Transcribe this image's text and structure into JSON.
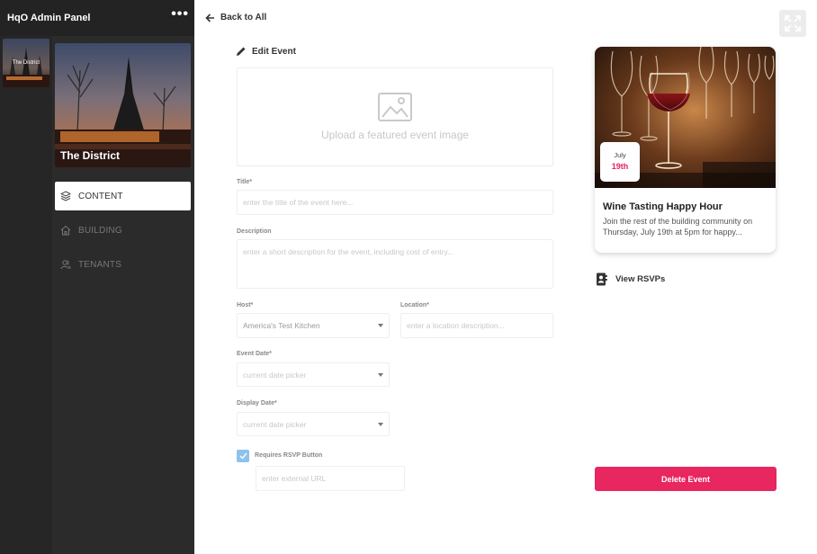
{
  "app": {
    "title": "HqO Admin Panel",
    "menu_icon": "more-dots-icon"
  },
  "sidebar": {
    "property_thumb_small_label": "The District",
    "property_name": "The District",
    "nav": [
      {
        "label": "CONTENT",
        "icon": "layers-icon",
        "active": true
      },
      {
        "label": "BUILDING",
        "icon": "home-icon",
        "active": false
      },
      {
        "label": "TENANTS",
        "icon": "users-icon",
        "active": false
      }
    ]
  },
  "header": {
    "back_label": "Back to All",
    "expand_icon": "expand-icon"
  },
  "form": {
    "section_title": "Edit Event",
    "upload_text": "Upload a featured event image",
    "title": {
      "label": "Title*",
      "placeholder": "enter the title of the event here..."
    },
    "description": {
      "label": "Description",
      "placeholder": "enter a short description for the event, including cost of entry..."
    },
    "host": {
      "label": "Host*",
      "value": "America's Test Kitchen"
    },
    "location": {
      "label": "Location*",
      "placeholder": "enter a location description..."
    },
    "event_date": {
      "label": "Event Date*",
      "placeholder": "current date picker"
    },
    "display_date": {
      "label": "Display Date*",
      "placeholder": "current date picker"
    },
    "rsvp": {
      "label": "Requires RSVP Button",
      "checked": true,
      "url_placeholder": "enter external URL"
    }
  },
  "preview": {
    "month": "July",
    "day": "19th",
    "title": "Wine Tasting Happy Hour",
    "description": "Join the rest of the building community on Thursday, July 19th at 5pm for happy..."
  },
  "actions": {
    "view_rsvps": "View RSVPs",
    "delete": "Delete Event"
  },
  "colors": {
    "accent": "#e8265f",
    "sidebar": "#2b2b2b",
    "checkbox": "#8fc2ea"
  }
}
